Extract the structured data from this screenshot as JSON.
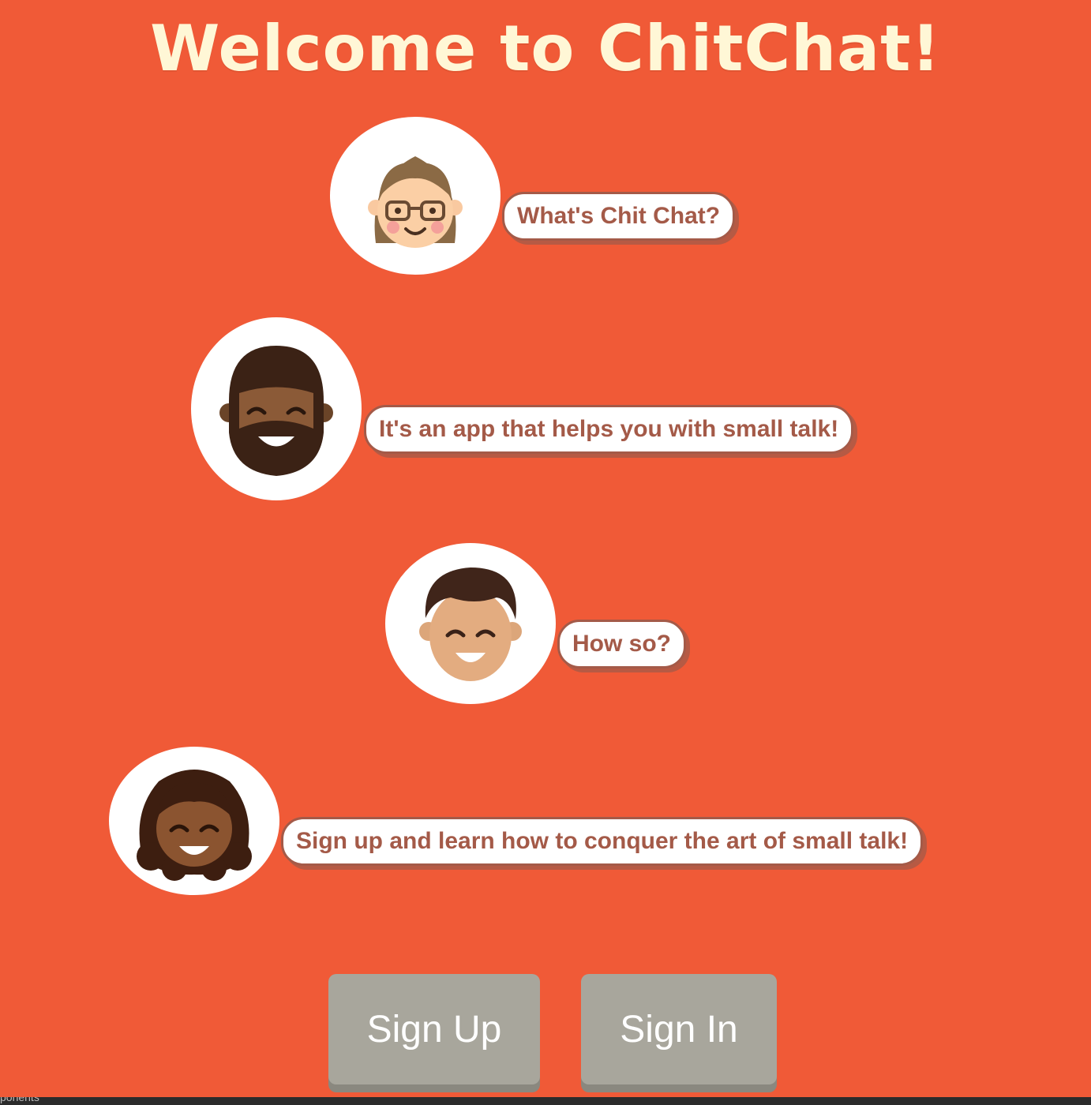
{
  "title": "Welcome to ChitChat!",
  "colors": {
    "background": "#f05a37",
    "title": "#fff7d6",
    "bubble_text": "#a45a48",
    "button": "#a8a69c"
  },
  "conversation": [
    {
      "avatar": "woman-glasses-avatar",
      "text": "What's Chit Chat?"
    },
    {
      "avatar": "bearded-man-avatar",
      "text": "It's an app that helps you with small talk!"
    },
    {
      "avatar": "smiling-boy-avatar",
      "text": "How so?"
    },
    {
      "avatar": "curly-hair-woman-avatar",
      "text": "Sign up and learn how to conquer the art of small talk!"
    }
  ],
  "buttons": {
    "sign_up": "Sign Up",
    "sign_in": "Sign In"
  },
  "taskbar": {
    "left_text": "ponents"
  }
}
